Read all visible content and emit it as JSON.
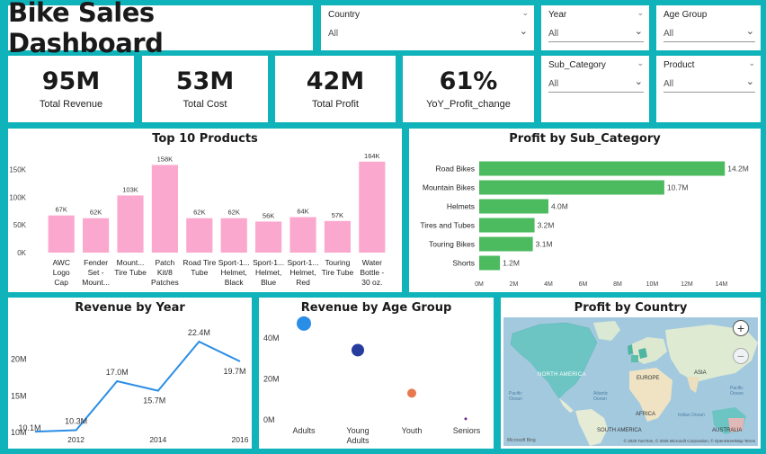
{
  "title": "Bike Sales Dashboard",
  "slicers": {
    "country": {
      "label": "Country",
      "value": "All"
    },
    "year": {
      "label": "Year",
      "value": "All"
    },
    "age_group": {
      "label": "Age Group",
      "value": "All"
    },
    "sub_category": {
      "label": "Sub_Category",
      "value": "All"
    },
    "product": {
      "label": "Product",
      "value": "All"
    }
  },
  "kpis": {
    "revenue": {
      "value": "95M",
      "label": "Total Revenue"
    },
    "cost": {
      "value": "53M",
      "label": "Total Cost"
    },
    "profit": {
      "value": "42M",
      "label": "Total  Profit"
    },
    "yoy": {
      "value": "61%",
      "label": "YoY_Profit_change"
    }
  },
  "colors": {
    "bg": "#0fb3b9",
    "pink": "#fba8cf",
    "green": "#4cba5f",
    "blue": "#2a8ee6",
    "navy": "#263d9e",
    "orange": "#e8794f",
    "purple": "#6a2a8c"
  },
  "top_products": {
    "title": "Top 10 Products",
    "chart_data": {
      "type": "bar",
      "categories": [
        [
          "AWC",
          "Logo",
          "Cap"
        ],
        [
          "Fender",
          "Set -",
          "Mount..."
        ],
        [
          "Mount...",
          "Tire Tube"
        ],
        [
          "Patch",
          "Kit/8",
          "Patches"
        ],
        [
          "Road Tire",
          "Tube"
        ],
        [
          "Sport-1...",
          "Helmet,",
          "Black"
        ],
        [
          "Sport-1...",
          "Helmet,",
          "Blue"
        ],
        [
          "Sport-1...",
          "Helmet,",
          "Red"
        ],
        [
          "Touring",
          "Tire Tube"
        ],
        [
          "Water",
          "Bottle -",
          "30 oz."
        ]
      ],
      "values": [
        67,
        62,
        103,
        158,
        62,
        62,
        56,
        64,
        57,
        164
      ],
      "data_labels": [
        "67K",
        "62K",
        "103K",
        "158K",
        "62K",
        "62K",
        "56K",
        "64K",
        "57K",
        "164K"
      ],
      "y_ticks": [
        "0K",
        "50K",
        "100K",
        "150K"
      ],
      "ylim": [
        0,
        175
      ]
    }
  },
  "profit_subcat": {
    "title": "Profit by Sub_Category",
    "chart_data": {
      "type": "bar",
      "categories": [
        "Road Bikes",
        "Mountain Bikes",
        "Helmets",
        "Tires and Tubes",
        "Touring Bikes",
        "Shorts"
      ],
      "values": [
        14.2,
        10.7,
        4.0,
        3.2,
        3.1,
        1.2
      ],
      "data_labels": [
        "14.2M",
        "10.7M",
        "4.0M",
        "3.2M",
        "3.1M",
        "1.2M"
      ],
      "x_ticks": [
        "0M",
        "2M",
        "4M",
        "6M",
        "8M",
        "10M",
        "12M",
        "14M"
      ],
      "xlim": [
        0,
        14.5
      ]
    }
  },
  "revenue_year": {
    "title": "Revenue by Year",
    "chart_data": {
      "type": "line",
      "x": [
        2011,
        2012,
        2013,
        2014,
        2015,
        2016
      ],
      "values": [
        10.1,
        10.3,
        17.0,
        15.7,
        22.4,
        19.7
      ],
      "data_labels": [
        "10.1M",
        "10.3M",
        "17.0M",
        "15.7M",
        "22.4M",
        "19.7M"
      ],
      "x_ticks": [
        "2012",
        "2014",
        "2016"
      ],
      "y_ticks": [
        "10M",
        "15M",
        "20M"
      ],
      "ylim": [
        10,
        24
      ]
    }
  },
  "revenue_age": {
    "title": "Revenue by Age Group",
    "chart_data": {
      "type": "scatter",
      "categories": [
        "Adults",
        "Young Adults",
        "Youth",
        "Seniors"
      ],
      "category_labels": [
        [
          "Adults"
        ],
        [
          "Young",
          "Adults"
        ],
        [
          "Youth"
        ],
        [
          "Seniors"
        ]
      ],
      "values": [
        47,
        34,
        13,
        0.5
      ],
      "y_ticks": [
        "0M",
        "20M",
        "40M"
      ],
      "ylim": [
        0,
        50
      ]
    }
  },
  "profit_country": {
    "title": "Profit by Country",
    "labels": {
      "na": "NORTH AMERICA",
      "eu": "EUROPE",
      "asia": "ASIA",
      "africa": "AFRICA",
      "sa": "SOUTH AMERICA",
      "au": "AUSTRALIA",
      "pac1": "Pacific Ocean",
      "atl": "Atlantic Ocean",
      "ind": "Indian Ocean",
      "pac2": "Pacific Ocean"
    },
    "attribution": "© 2025 TomTom, © 2025 Microsoft Corporation, © OpenStreetMap  Terms",
    "brand": "Microsoft Bing",
    "zoom_in": "+",
    "zoom_out": "−"
  }
}
